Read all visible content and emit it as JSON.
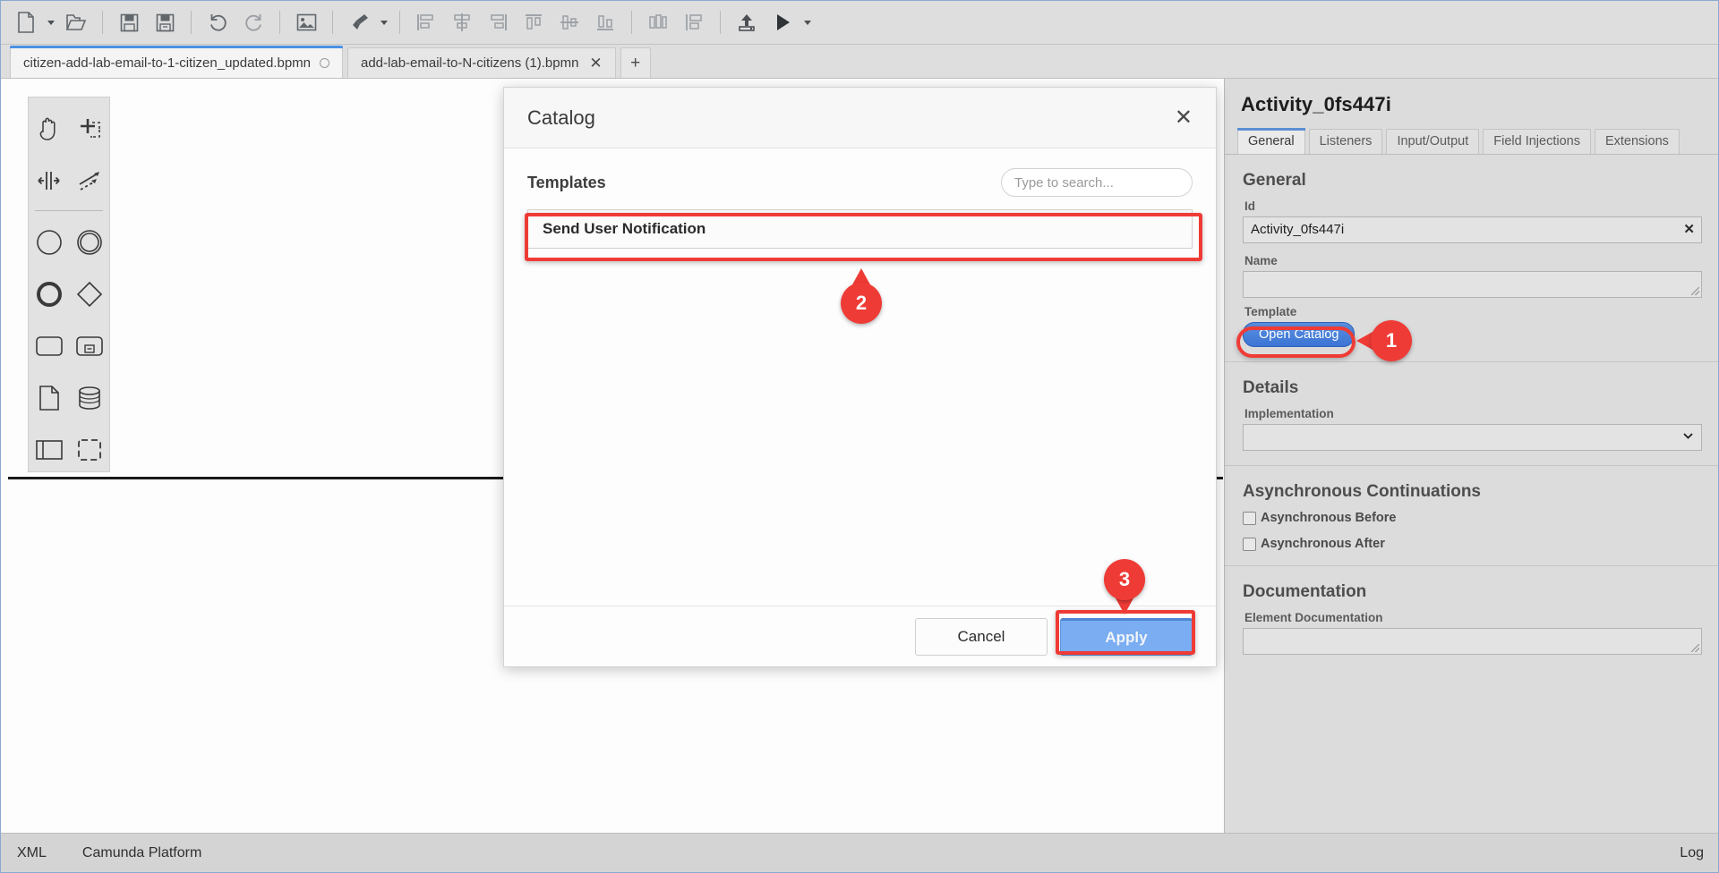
{
  "toolbar": {
    "items": [
      {
        "name": "new-file-icon",
        "label": "New File"
      },
      {
        "name": "new-file-dropdown-caret",
        "label": "New File Options"
      },
      {
        "name": "open-file-icon",
        "label": "Open File"
      },
      {
        "name": "save-icon",
        "label": "Save"
      },
      {
        "name": "save-as-icon",
        "label": "Save As"
      },
      {
        "name": "undo-icon",
        "label": "Undo"
      },
      {
        "name": "redo-icon",
        "label": "Redo"
      },
      {
        "name": "export-image-icon",
        "label": "Export as Image"
      },
      {
        "name": "format-brush-icon",
        "label": "Format"
      },
      {
        "name": "format-dropdown-caret",
        "label": "Format Options"
      },
      {
        "name": "align-left-icon",
        "label": "Align Left"
      },
      {
        "name": "align-center-icon",
        "label": "Align Center"
      },
      {
        "name": "align-right-icon",
        "label": "Align Right"
      },
      {
        "name": "align-top-icon",
        "label": "Align Top"
      },
      {
        "name": "align-middle-icon",
        "label": "Align Middle"
      },
      {
        "name": "align-bottom-icon",
        "label": "Align Bottom"
      },
      {
        "name": "distribute-horizontal-icon",
        "label": "Distribute Horizontally"
      },
      {
        "name": "distribute-vertical-icon",
        "label": "Distribute Vertically"
      },
      {
        "name": "deploy-icon",
        "label": "Deploy"
      },
      {
        "name": "run-icon",
        "label": "Start Process Instance"
      },
      {
        "name": "run-dropdown-caret",
        "label": "Run Options"
      }
    ]
  },
  "tabs": {
    "items": [
      {
        "label": "citizen-add-lab-email-to-1-citizen_updated.bpmn",
        "active": true,
        "dirty": true
      },
      {
        "label": "add-lab-email-to-N-citizens (1).bpmn",
        "active": false,
        "dirty": false
      }
    ],
    "add_label": "+"
  },
  "palette": {
    "items": [
      {
        "name": "hand-tool-icon",
        "label": "Activate hand tool"
      },
      {
        "name": "lasso-tool-icon",
        "label": "Activate lasso tool"
      },
      {
        "name": "space-tool-icon",
        "label": "Activate create/remove space tool"
      },
      {
        "name": "global-connect-tool-icon",
        "label": "Activate global connect tool"
      },
      {
        "name": "start-event-icon",
        "label": "Create StartEvent"
      },
      {
        "name": "intermediate-event-icon",
        "label": "Create Intermediate/Boundary Event"
      },
      {
        "name": "end-event-icon",
        "label": "Create EndEvent"
      },
      {
        "name": "gateway-icon",
        "label": "Create Gateway"
      },
      {
        "name": "task-icon",
        "label": "Create Task"
      },
      {
        "name": "subprocess-icon",
        "label": "Create expanded SubProcess"
      },
      {
        "name": "data-object-icon",
        "label": "Create DataObjectReference"
      },
      {
        "name": "data-store-icon",
        "label": "Create DataStoreReference"
      },
      {
        "name": "participant-icon",
        "label": "Create Pool/Participant"
      },
      {
        "name": "group-icon",
        "label": "Create Group"
      }
    ]
  },
  "modal": {
    "title": "Catalog",
    "close_label": "✕",
    "templates_label": "Templates",
    "search": {
      "placeholder": "Type to search...",
      "value": "",
      "icon": "search-icon"
    },
    "templates": [
      {
        "label": "Send User Notification",
        "selected": true
      }
    ],
    "cancel_label": "Cancel",
    "apply_label": "Apply"
  },
  "properties": {
    "title": "Activity_0fs447i",
    "tabs": [
      {
        "label": "General",
        "active": true
      },
      {
        "label": "Listeners",
        "active": false
      },
      {
        "label": "Input/Output",
        "active": false
      },
      {
        "label": "Field Injections",
        "active": false
      },
      {
        "label": "Extensions",
        "active": false
      }
    ],
    "general": {
      "heading": "General",
      "id_label": "Id",
      "id_value": "Activity_0fs447i",
      "id_clear_label": "✕",
      "name_label": "Name",
      "name_value": "",
      "template_label": "Template",
      "open_catalog_label": "Open Catalog"
    },
    "details": {
      "heading": "Details",
      "implementation_label": "Implementation",
      "implementation_value": ""
    },
    "async": {
      "heading": "Asynchronous Continuations",
      "before_label": "Asynchronous Before",
      "before_checked": false,
      "after_label": "Asynchronous After",
      "after_checked": false
    },
    "documentation": {
      "heading": "Documentation",
      "element_documentation_label": "Element Documentation",
      "element_documentation_value": ""
    }
  },
  "statusbar": {
    "xml_label": "XML",
    "engine_label": "Camunda Platform",
    "log_label": "Log"
  },
  "annotations": {
    "step1": "1",
    "step2": "2",
    "step3": "3"
  },
  "colors": {
    "accent_blue": "#4a90e2",
    "button_blue": "#3b75d4",
    "annotation_red": "#ef3b36",
    "chrome_gray": "#dedede"
  }
}
